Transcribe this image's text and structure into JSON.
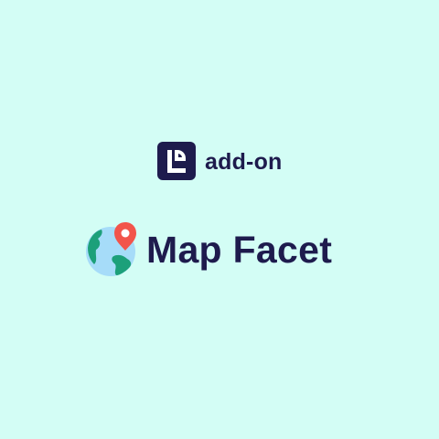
{
  "badge": {
    "label": "add-on",
    "logo_icon": "addon-logo-icon",
    "logo_color": "#1e1b4d"
  },
  "product": {
    "title": "Map Facet",
    "icon": "globe-with-pin-icon",
    "text_color": "#1e1b4d",
    "globe_water_color": "#a6dcf9",
    "globe_land_color": "#1ca07a",
    "pin_color": "#f2544b"
  },
  "background_color": "#d3fdf5"
}
